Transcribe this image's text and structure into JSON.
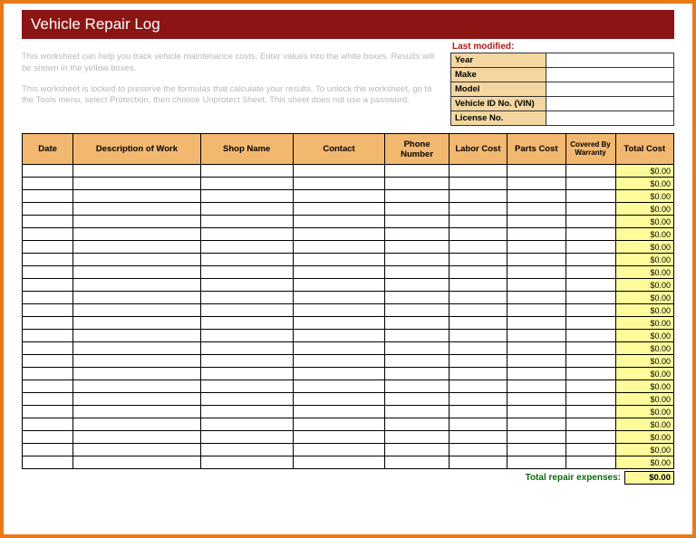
{
  "title": "Vehicle Repair Log",
  "instructions": {
    "p1": "This worksheet can help you track vehicle maintenance costs. Enter values into the white boxes. Results will be shown in the yellow boxes.",
    "p2": "This worksheet is locked to preserve the formulas that calculate your results. To unlock the worksheet, go to the Tools menu, select Protection, then choose Unprotect Sheet. This sheet does not use a password."
  },
  "last_modified_label": "Last modified:",
  "vehicle_info": [
    {
      "label": "Year",
      "value": ""
    },
    {
      "label": "Make",
      "value": ""
    },
    {
      "label": "Model",
      "value": ""
    },
    {
      "label": "Vehicle ID No. (VIN)",
      "value": ""
    },
    {
      "label": "License No.",
      "value": ""
    }
  ],
  "columns": {
    "date": "Date",
    "desc": "Description of Work",
    "shop": "Shop Name",
    "contact": "Contact",
    "phone": "Phone Number",
    "labor": "Labor Cost",
    "parts": "Parts Cost",
    "warranty": "Covered By Warranty",
    "total": "Total Cost"
  },
  "rows": [
    {
      "date": "",
      "desc": "",
      "shop": "",
      "contact": "",
      "phone": "",
      "labor": "",
      "parts": "",
      "warranty": "",
      "total": "$0.00"
    },
    {
      "date": "",
      "desc": "",
      "shop": "",
      "contact": "",
      "phone": "",
      "labor": "",
      "parts": "",
      "warranty": "",
      "total": "$0.00"
    },
    {
      "date": "",
      "desc": "",
      "shop": "",
      "contact": "",
      "phone": "",
      "labor": "",
      "parts": "",
      "warranty": "",
      "total": "$0.00"
    },
    {
      "date": "",
      "desc": "",
      "shop": "",
      "contact": "",
      "phone": "",
      "labor": "",
      "parts": "",
      "warranty": "",
      "total": "$0.00"
    },
    {
      "date": "",
      "desc": "",
      "shop": "",
      "contact": "",
      "phone": "",
      "labor": "",
      "parts": "",
      "warranty": "",
      "total": "$0.00"
    },
    {
      "date": "",
      "desc": "",
      "shop": "",
      "contact": "",
      "phone": "",
      "labor": "",
      "parts": "",
      "warranty": "",
      "total": "$0.00"
    },
    {
      "date": "",
      "desc": "",
      "shop": "",
      "contact": "",
      "phone": "",
      "labor": "",
      "parts": "",
      "warranty": "",
      "total": "$0.00"
    },
    {
      "date": "",
      "desc": "",
      "shop": "",
      "contact": "",
      "phone": "",
      "labor": "",
      "parts": "",
      "warranty": "",
      "total": "$0.00"
    },
    {
      "date": "",
      "desc": "",
      "shop": "",
      "contact": "",
      "phone": "",
      "labor": "",
      "parts": "",
      "warranty": "",
      "total": "$0.00"
    },
    {
      "date": "",
      "desc": "",
      "shop": "",
      "contact": "",
      "phone": "",
      "labor": "",
      "parts": "",
      "warranty": "",
      "total": "$0.00"
    },
    {
      "date": "",
      "desc": "",
      "shop": "",
      "contact": "",
      "phone": "",
      "labor": "",
      "parts": "",
      "warranty": "",
      "total": "$0.00"
    },
    {
      "date": "",
      "desc": "",
      "shop": "",
      "contact": "",
      "phone": "",
      "labor": "",
      "parts": "",
      "warranty": "",
      "total": "$0.00"
    },
    {
      "date": "",
      "desc": "",
      "shop": "",
      "contact": "",
      "phone": "",
      "labor": "",
      "parts": "",
      "warranty": "",
      "total": "$0.00"
    },
    {
      "date": "",
      "desc": "",
      "shop": "",
      "contact": "",
      "phone": "",
      "labor": "",
      "parts": "",
      "warranty": "",
      "total": "$0.00"
    },
    {
      "date": "",
      "desc": "",
      "shop": "",
      "contact": "",
      "phone": "",
      "labor": "",
      "parts": "",
      "warranty": "",
      "total": "$0.00"
    },
    {
      "date": "",
      "desc": "",
      "shop": "",
      "contact": "",
      "phone": "",
      "labor": "",
      "parts": "",
      "warranty": "",
      "total": "$0.00"
    },
    {
      "date": "",
      "desc": "",
      "shop": "",
      "contact": "",
      "phone": "",
      "labor": "",
      "parts": "",
      "warranty": "",
      "total": "$0.00"
    },
    {
      "date": "",
      "desc": "",
      "shop": "",
      "contact": "",
      "phone": "",
      "labor": "",
      "parts": "",
      "warranty": "",
      "total": "$0.00"
    },
    {
      "date": "",
      "desc": "",
      "shop": "",
      "contact": "",
      "phone": "",
      "labor": "",
      "parts": "",
      "warranty": "",
      "total": "$0.00"
    },
    {
      "date": "",
      "desc": "",
      "shop": "",
      "contact": "",
      "phone": "",
      "labor": "",
      "parts": "",
      "warranty": "",
      "total": "$0.00"
    },
    {
      "date": "",
      "desc": "",
      "shop": "",
      "contact": "",
      "phone": "",
      "labor": "",
      "parts": "",
      "warranty": "",
      "total": "$0.00"
    },
    {
      "date": "",
      "desc": "",
      "shop": "",
      "contact": "",
      "phone": "",
      "labor": "",
      "parts": "",
      "warranty": "",
      "total": "$0.00"
    },
    {
      "date": "",
      "desc": "",
      "shop": "",
      "contact": "",
      "phone": "",
      "labor": "",
      "parts": "",
      "warranty": "",
      "total": "$0.00"
    },
    {
      "date": "",
      "desc": "",
      "shop": "",
      "contact": "",
      "phone": "",
      "labor": "",
      "parts": "",
      "warranty": "",
      "total": "$0.00"
    }
  ],
  "footer": {
    "label": "Total repair expenses:",
    "total": "$0.00"
  }
}
